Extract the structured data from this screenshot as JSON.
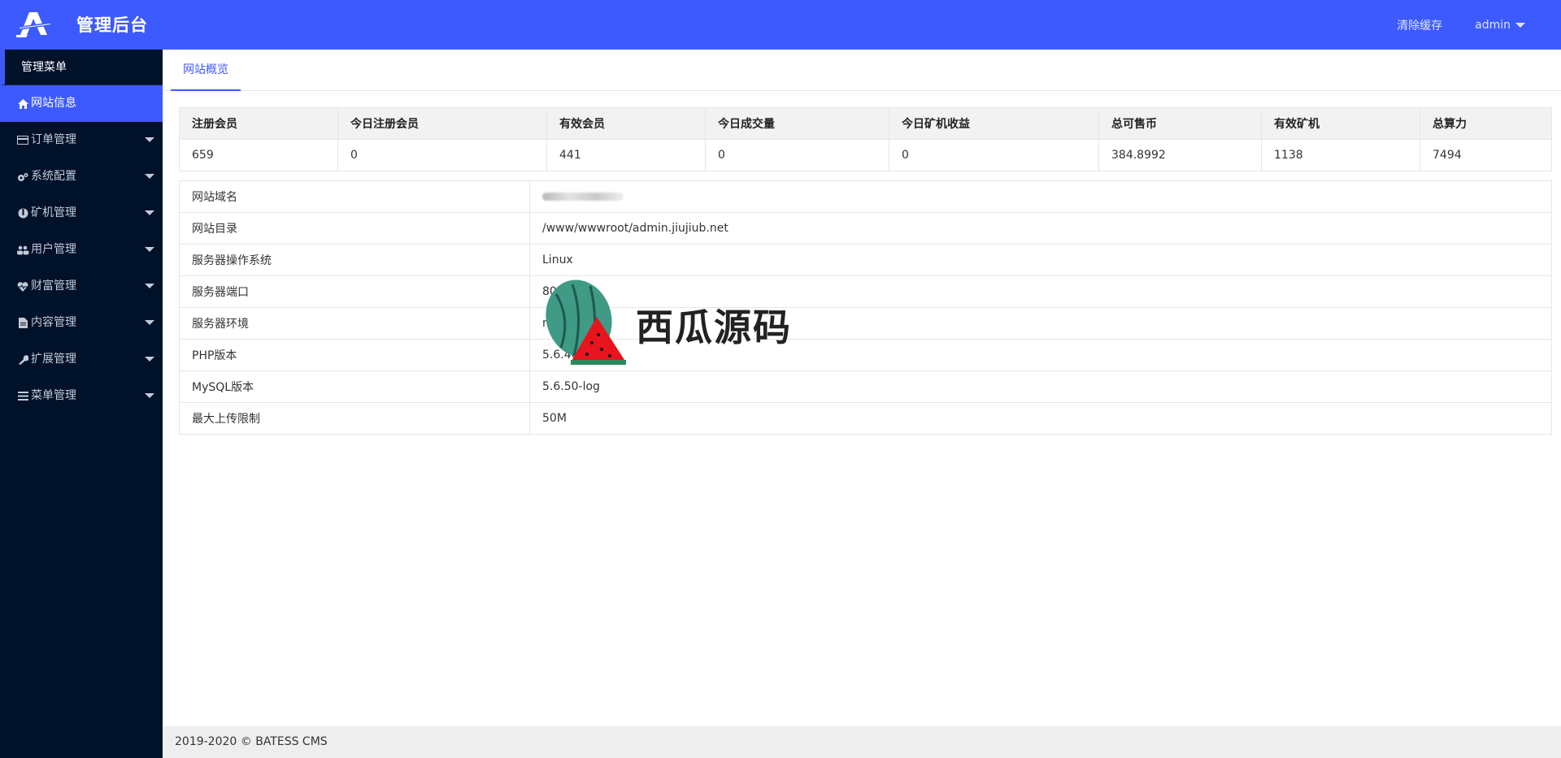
{
  "header": {
    "logo_text": "管理后台",
    "clear_cache": "清除缓存",
    "user": "admin"
  },
  "sidebar": {
    "title": "管理菜单",
    "items": [
      {
        "label": "网站信息",
        "icon": "home-icon",
        "active": true
      },
      {
        "label": "订单管理",
        "icon": "credit-card-icon"
      },
      {
        "label": "系统配置",
        "icon": "gears-icon"
      },
      {
        "label": "矿机管理",
        "icon": "rebel-icon"
      },
      {
        "label": "用户管理",
        "icon": "users-icon"
      },
      {
        "label": "财富管理",
        "icon": "heartbeat-icon"
      },
      {
        "label": "内容管理",
        "icon": "file-text-icon"
      },
      {
        "label": "扩展管理",
        "icon": "wrench-icon"
      },
      {
        "label": "菜单管理",
        "icon": "bars-icon"
      }
    ]
  },
  "tabs": [
    {
      "label": "网站概览"
    }
  ],
  "stats": {
    "headers": [
      "注册会员",
      "今日注册会员",
      "有效会员",
      "今日成交量",
      "今日矿机收益",
      "总可售币",
      "有效矿机",
      "总算力"
    ],
    "values": [
      "659",
      "0",
      "441",
      "0",
      "0",
      "384.8992",
      "1138",
      "7494"
    ]
  },
  "info": {
    "rows": [
      {
        "key": "网站域名",
        "value": ""
      },
      {
        "key": "网站目录",
        "value": "/www/wwwroot/admin.jiujiub.net"
      },
      {
        "key": "服务器操作系统",
        "value": "Linux"
      },
      {
        "key": "服务器端口",
        "value": "80"
      },
      {
        "key": "服务器环境",
        "value": "n"
      },
      {
        "key": "PHP版本",
        "value": "5.6.40"
      },
      {
        "key": "MySQL版本",
        "value": "5.6.50-log"
      },
      {
        "key": "最大上传限制",
        "value": "50M"
      }
    ]
  },
  "footer": {
    "text": "2019-2020 © BATESS CMS"
  },
  "watermark": {
    "text": "西瓜源码"
  },
  "colors": {
    "accent": "#3d5afe",
    "sidebar_bg": "#00112a"
  }
}
